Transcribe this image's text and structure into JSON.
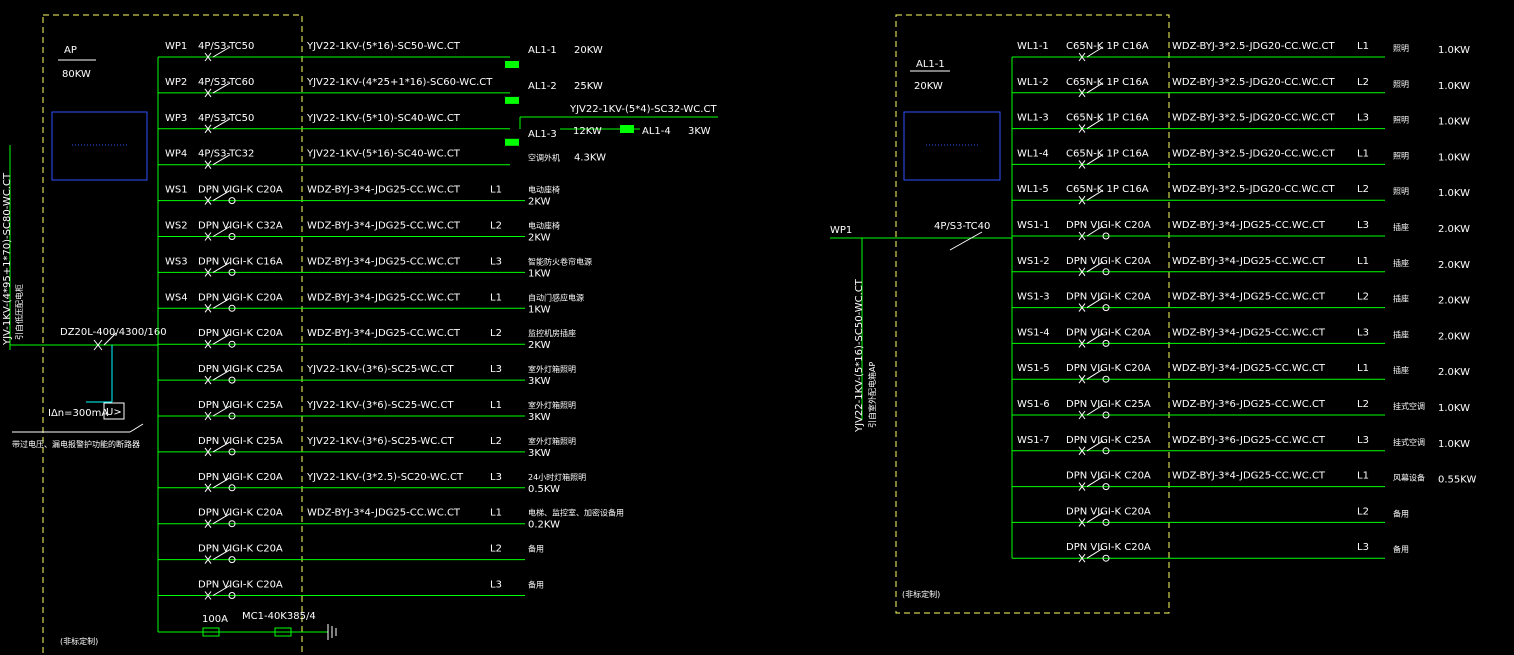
{
  "colors": {
    "background": "#000000",
    "wire": "#00ff00",
    "boundary": "#ffff66",
    "text": "#ffffff",
    "accent": "#00ffff",
    "panel": "#2b50ff"
  },
  "left_panel": {
    "name": "AP",
    "power": "80KW",
    "incoming_cable": "YJV-1KV-(4*95+1*70)-SC80-WC.CT",
    "incoming_note": "引自低压配电柜",
    "main_breaker": "DZ20L-400/4300/160",
    "leakage": "IΔn=300mA",
    "leakage_box": "U>",
    "leakage_note": "带过电压、漏电报警护功能的断路器",
    "spd_breaker": "100A",
    "spd": "MC1-40K385/4",
    "footer": "(非标定制)",
    "circuits": [
      {
        "id": "WP1",
        "breaker": "4P/S3-TC50",
        "cable": "YJV22-1KV-(5*16)-SC50-WC.CT",
        "load": "AL1-1",
        "phase": "",
        "power": "20KW"
      },
      {
        "id": "WP2",
        "breaker": "4P/S3-TC60",
        "cable": "YJV22-1KV-(4*25+1*16)-SC60-WC.CT",
        "load": "AL1-2",
        "phase": "",
        "power": "25KW"
      },
      {
        "id": "WP3",
        "breaker": "4P/S3-TC50",
        "cable": "YJV22-1KV-(5*10)-SC40-WC.CT",
        "load": "AL1-3",
        "phase": "",
        "power": ""
      },
      {
        "id": "WP4",
        "breaker": "4P/S3-TC32",
        "cable": "YJV22-1KV-(5*16)-SC40-WC.CT",
        "load": "空调外机",
        "phase": "",
        "power": "4.3KW"
      },
      {
        "id": "WS1",
        "breaker": "DPN VIGI-K C20A",
        "cable": "WDZ-BYJ-3*4-JDG25-CC.WC.CT",
        "load": "电动座椅",
        "phase": "L1",
        "power": "2KW"
      },
      {
        "id": "WS2",
        "breaker": "DPN VIGI-K C32A",
        "cable": "WDZ-BYJ-3*4-JDG25-CC.WC.CT",
        "load": "电动座椅",
        "phase": "L2",
        "power": "2KW"
      },
      {
        "id": "WS3",
        "breaker": "DPN VIGI-K C16A",
        "cable": "WDZ-BYJ-3*4-JDG25-CC.WC.CT",
        "load": "智能防火卷帘电源",
        "phase": "L3",
        "power": "1KW"
      },
      {
        "id": "WS4",
        "breaker": "DPN VIGI-K C20A",
        "cable": "WDZ-BYJ-3*4-JDG25-CC.WC.CT",
        "load": "自动门感应电源",
        "phase": "L1",
        "power": "1KW"
      },
      {
        "id": "",
        "breaker": "DPN VIGI-K C20A",
        "cable": "WDZ-BYJ-3*4-JDG25-CC.WC.CT",
        "load": "监控机房插座",
        "phase": "L2",
        "power": "2KW"
      },
      {
        "id": "",
        "breaker": "DPN VIGI-K C25A",
        "cable": "YJV22-1KV-(3*6)-SC25-WC.CT",
        "load": "室外灯箱照明",
        "phase": "L3",
        "power": "3KW"
      },
      {
        "id": "",
        "breaker": "DPN VIGI-K C25A",
        "cable": "YJV22-1KV-(3*6)-SC25-WC.CT",
        "load": "室外灯箱照明",
        "phase": "L1",
        "power": "3KW"
      },
      {
        "id": "",
        "breaker": "DPN VIGI-K C25A",
        "cable": "YJV22-1KV-(3*6)-SC25-WC.CT",
        "load": "室外灯箱照明",
        "phase": "L2",
        "power": "3KW"
      },
      {
        "id": "",
        "breaker": "DPN VIGI-K C20A",
        "cable": "YJV22-1KV-(3*2.5)-SC20-WC.CT",
        "load": "24小时灯箱照明",
        "phase": "L3",
        "power": "0.5KW"
      },
      {
        "id": "",
        "breaker": "DPN VIGI-K C20A",
        "cable": "WDZ-BYJ-3*4-JDG25-CC.WC.CT",
        "load": "电梯、监控室、加密设备用",
        "phase": "L1",
        "power": "0.2KW"
      },
      {
        "id": "",
        "breaker": "DPN VIGI-K C20A",
        "cable": "",
        "load": "备用",
        "phase": "L2",
        "power": ""
      },
      {
        "id": "",
        "breaker": "DPN VIGI-K C20A",
        "cable": "",
        "load": "备用",
        "phase": "L3",
        "power": ""
      }
    ],
    "branch": {
      "cable": "YJV22-1KV-(5*4)-SC32-WC.CT",
      "power_a": "12KW",
      "load_b": "AL1-4",
      "power_b": "3KW"
    }
  },
  "right_panel": {
    "name": "AL1-1",
    "power": "20KW",
    "incoming_id": "WP1",
    "main_breaker": "4P/S3-TC40",
    "incoming_cable": "YJV22-1KV-(5*16)-SC50-WC.CT",
    "incoming_note": "引自室外配电箱AP",
    "footer": "(非标定制)",
    "circuits": [
      {
        "id": "WL1-1",
        "breaker": "C65N-K 1P C16A",
        "cable": "WDZ-BYJ-3*2.5-JDG20-CC.WC.CT",
        "phase": "L1",
        "load": "照明",
        "power": "1.0KW"
      },
      {
        "id": "WL1-2",
        "breaker": "C65N-K 1P C16A",
        "cable": "WDZ-BYJ-3*2.5-JDG20-CC.WC.CT",
        "phase": "L2",
        "load": "照明",
        "power": "1.0KW"
      },
      {
        "id": "WL1-3",
        "breaker": "C65N-K 1P C16A",
        "cable": "WDZ-BYJ-3*2.5-JDG20-CC.WC.CT",
        "phase": "L3",
        "load": "照明",
        "power": "1.0KW"
      },
      {
        "id": "WL1-4",
        "breaker": "C65N-K 1P C16A",
        "cable": "WDZ-BYJ-3*2.5-JDG20-CC.WC.CT",
        "phase": "L1",
        "load": "照明",
        "power": "1.0KW"
      },
      {
        "id": "WL1-5",
        "breaker": "C65N-K 1P C16A",
        "cable": "WDZ-BYJ-3*2.5-JDG20-CC.WC.CT",
        "phase": "L2",
        "load": "照明",
        "power": "1.0KW"
      },
      {
        "id": "WS1-1",
        "breaker": "DPN VIGI-K C20A",
        "cable": "WDZ-BYJ-3*4-JDG25-CC.WC.CT",
        "phase": "L3",
        "load": "插座",
        "power": "2.0KW"
      },
      {
        "id": "WS1-2",
        "breaker": "DPN VIGI-K C20A",
        "cable": "WDZ-BYJ-3*4-JDG25-CC.WC.CT",
        "phase": "L1",
        "load": "插座",
        "power": "2.0KW"
      },
      {
        "id": "WS1-3",
        "breaker": "DPN VIGI-K C20A",
        "cable": "WDZ-BYJ-3*4-JDG25-CC.WC.CT",
        "phase": "L2",
        "load": "插座",
        "power": "2.0KW"
      },
      {
        "id": "WS1-4",
        "breaker": "DPN VIGI-K C20A",
        "cable": "WDZ-BYJ-3*4-JDG25-CC.WC.CT",
        "phase": "L3",
        "load": "插座",
        "power": "2.0KW"
      },
      {
        "id": "WS1-5",
        "breaker": "DPN VIGI-K C20A",
        "cable": "WDZ-BYJ-3*4-JDG25-CC.WC.CT",
        "phase": "L1",
        "load": "插座",
        "power": "2.0KW"
      },
      {
        "id": "WS1-6",
        "breaker": "DPN VIGI-K C25A",
        "cable": "WDZ-BYJ-3*6-JDG25-CC.WC.CT",
        "phase": "L2",
        "load": "挂式空调",
        "power": "1.0KW"
      },
      {
        "id": "WS1-7",
        "breaker": "DPN VIGI-K C25A",
        "cable": "WDZ-BYJ-3*6-JDG25-CC.WC.CT",
        "phase": "L3",
        "load": "挂式空调",
        "power": "1.0KW"
      },
      {
        "id": "",
        "breaker": "DPN VIGI-K C20A",
        "cable": "WDZ-BYJ-3*4-JDG25-CC.WC.CT",
        "phase": "L1",
        "load": "风幕设备",
        "power": "0.55KW"
      },
      {
        "id": "",
        "breaker": "DPN VIGI-K C20A",
        "cable": "",
        "phase": "L2",
        "load": "备用",
        "power": ""
      },
      {
        "id": "",
        "breaker": "DPN VIGI-K C20A",
        "cable": "",
        "phase": "L3",
        "load": "备用",
        "power": ""
      }
    ]
  }
}
